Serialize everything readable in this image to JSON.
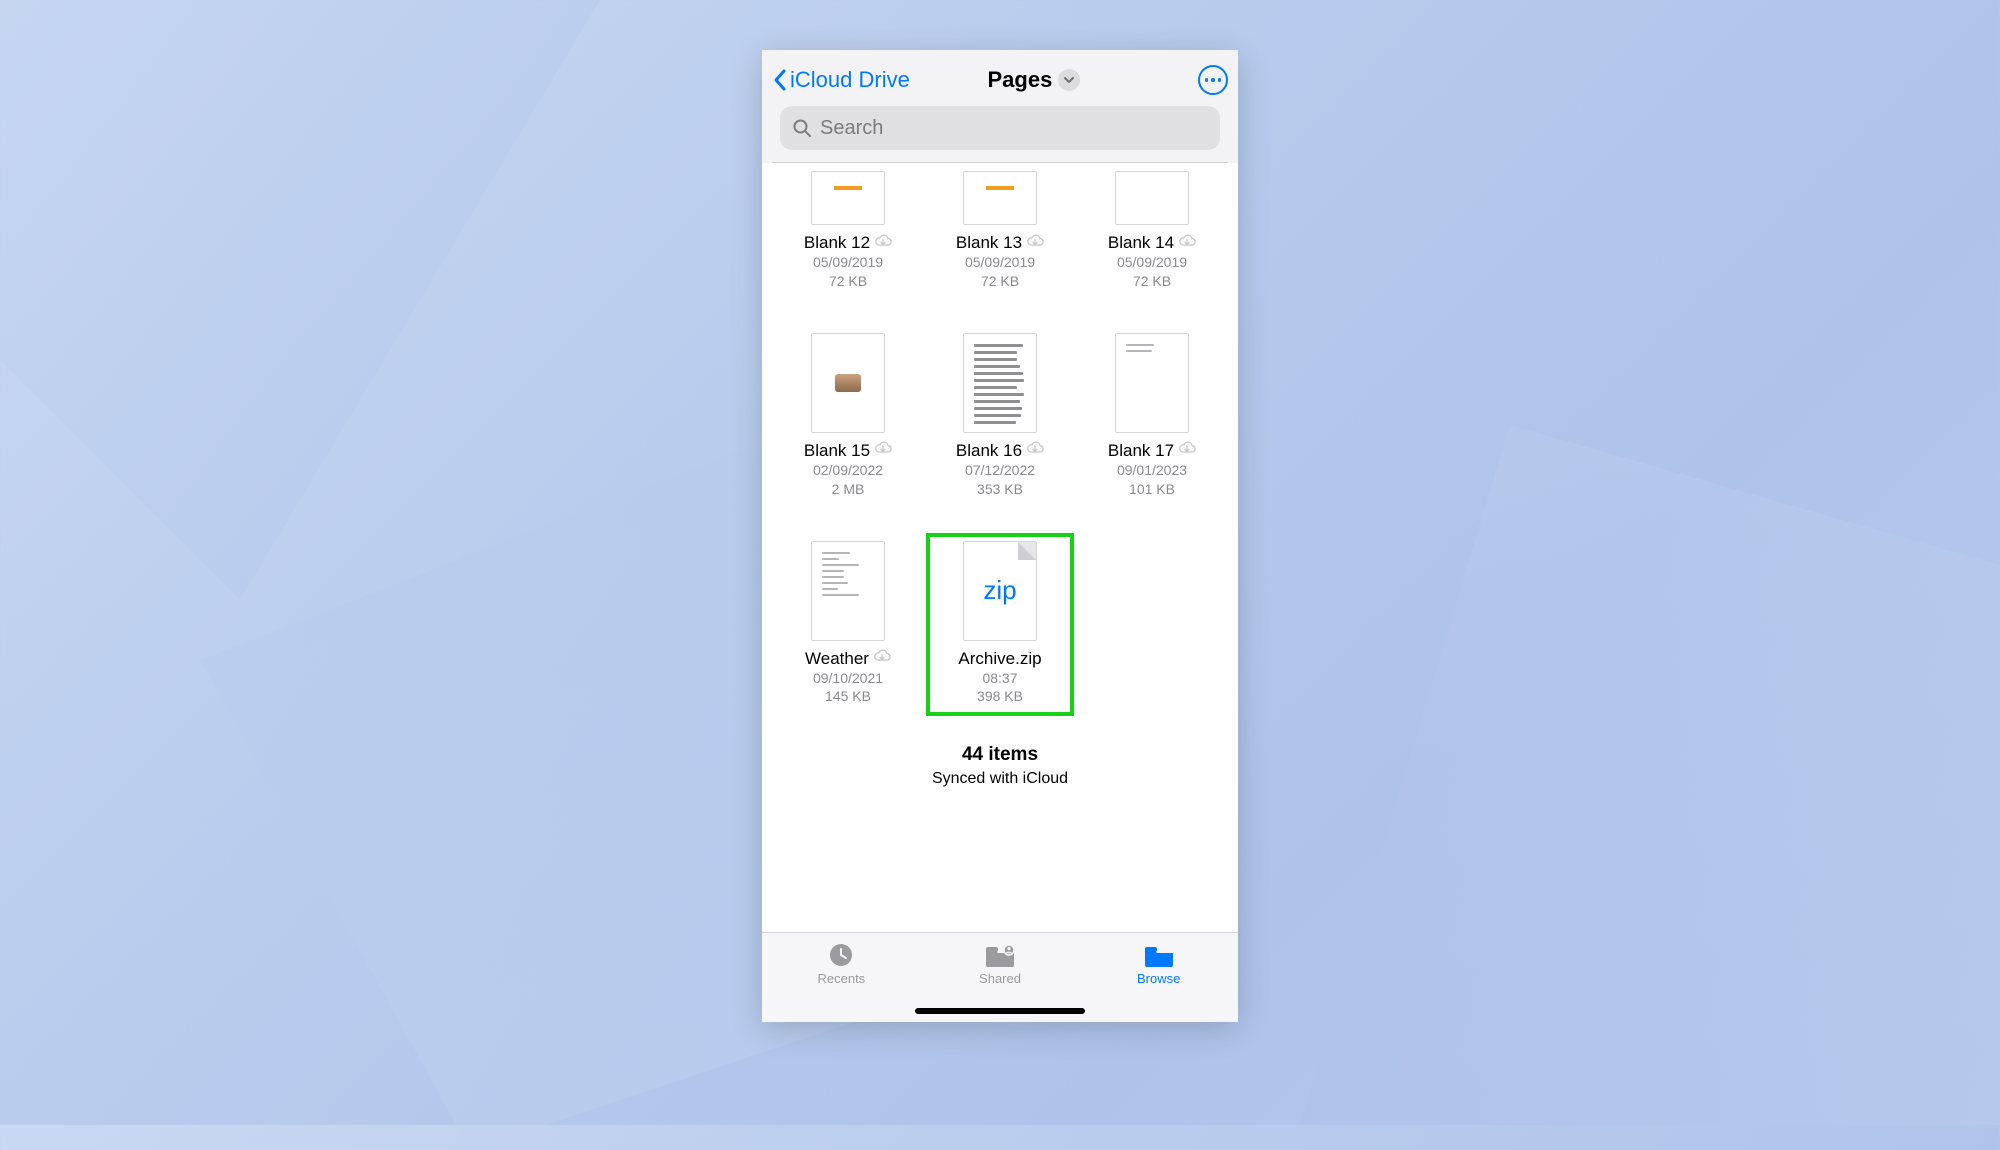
{
  "nav": {
    "back_label": "iCloud Drive",
    "title": "Pages"
  },
  "search": {
    "placeholder": "Search",
    "value": ""
  },
  "files": [
    {
      "name": "Blank 12",
      "date": "05/09/2019",
      "size": "72 KB",
      "thumb": "pages",
      "cloud": true,
      "row": 0
    },
    {
      "name": "Blank 13",
      "date": "05/09/2019",
      "size": "72 KB",
      "thumb": "pages",
      "cloud": true,
      "row": 0
    },
    {
      "name": "Blank 14",
      "date": "05/09/2019",
      "size": "72 KB",
      "thumb": "blank",
      "cloud": true,
      "row": 0
    },
    {
      "name": "Blank 15",
      "date": "02/09/2022",
      "size": "2 MB",
      "thumb": "pic",
      "cloud": true,
      "row": 1
    },
    {
      "name": "Blank 16",
      "date": "07/12/2022",
      "size": "353 KB",
      "thumb": "dense",
      "cloud": true,
      "row": 1
    },
    {
      "name": "Blank 17",
      "date": "09/01/2023",
      "size": "101 KB",
      "thumb": "sparse",
      "cloud": true,
      "row": 1
    },
    {
      "name": "Weather",
      "date": "09/10/2021",
      "size": "145 KB",
      "thumb": "list",
      "cloud": true,
      "row": 2
    },
    {
      "name": "Archive.zip",
      "date": "08:37",
      "size": "398 KB",
      "thumb": "zip",
      "cloud": false,
      "row": 2,
      "highlight": true
    }
  ],
  "status": {
    "count_label": "44 items",
    "sync_label": "Synced with iCloud"
  },
  "tabs": {
    "recents": "Recents",
    "shared": "Shared",
    "browse": "Browse",
    "active": "browse"
  },
  "zip_glyph": "zip"
}
